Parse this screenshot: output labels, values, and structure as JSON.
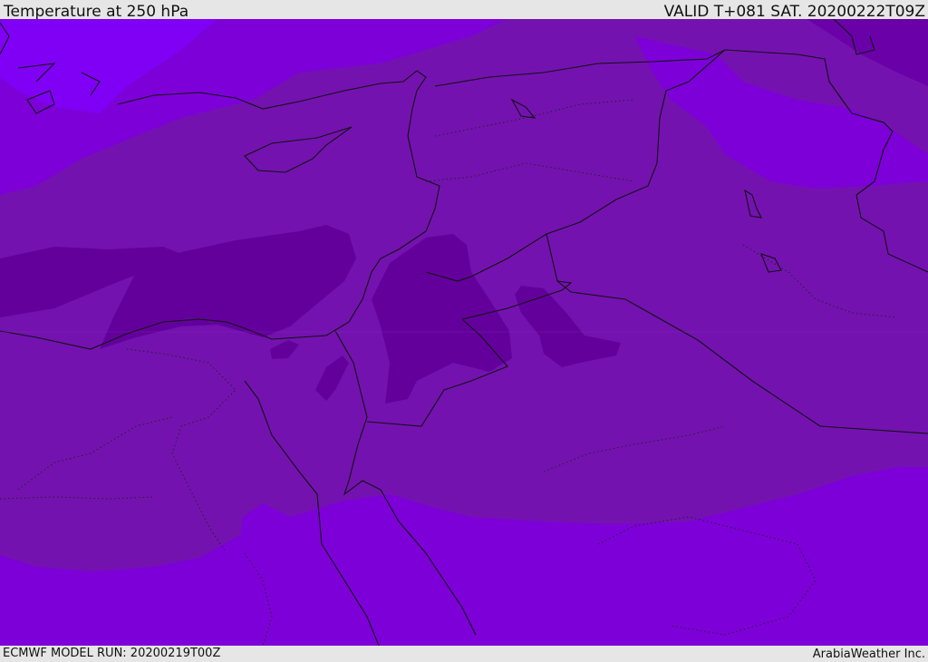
{
  "header": {
    "title": "Temperature at 250 hPa",
    "valid": "VALID T+081 SAT. 20200222T09Z"
  },
  "footer": {
    "model_run": "ECMWF MODEL RUN: 20200219T00Z",
    "credit": "ArabiaWeather Inc."
  },
  "colors": {
    "band_coldest": "#63009c",
    "band_cold": "#7412b0",
    "band_mid": "#7d00d8",
    "band_warm": "#8000f5",
    "band_top_right": "#6a00a8",
    "coastline": "#111111"
  }
}
